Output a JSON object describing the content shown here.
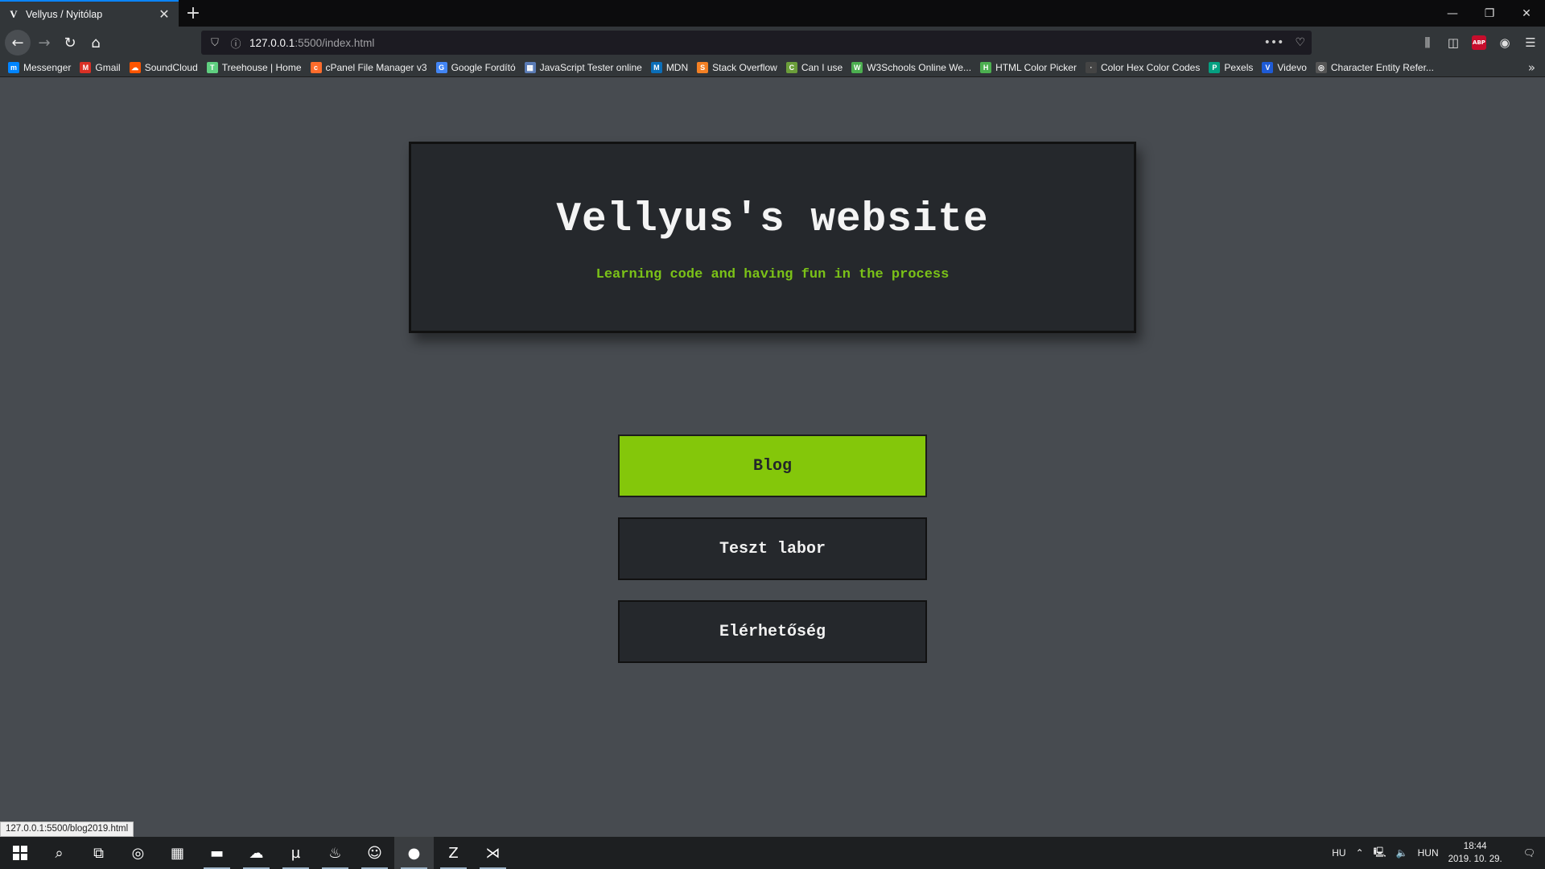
{
  "browser": {
    "tab": {
      "favicon": "V",
      "title": "Vellyus / Nyitólap"
    },
    "url": {
      "host": "127.0.0.1",
      "rest": ":5500/index.html"
    },
    "bookmarks": [
      {
        "label": "Messenger",
        "color": "#0084ff",
        "glyph": "m"
      },
      {
        "label": "Gmail",
        "color": "#d93025",
        "glyph": "M"
      },
      {
        "label": "SoundCloud",
        "color": "#ff5500",
        "glyph": "☁"
      },
      {
        "label": "Treehouse | Home",
        "color": "#5fcf80",
        "glyph": "T"
      },
      {
        "label": "cPanel File Manager v3",
        "color": "#ff6c2c",
        "glyph": "c"
      },
      {
        "label": "Google Fordító",
        "color": "#4285f4",
        "glyph": "G"
      },
      {
        "label": "JavaScript Tester online",
        "color": "#5a7bb5",
        "glyph": "▦"
      },
      {
        "label": "MDN",
        "color": "#0b6eb8",
        "glyph": "M"
      },
      {
        "label": "Stack Overflow",
        "color": "#f48024",
        "glyph": "S"
      },
      {
        "label": "Can I use",
        "color": "#6b9e3a",
        "glyph": "C"
      },
      {
        "label": "W3Schools Online We...",
        "color": "#4caf50",
        "glyph": "W"
      },
      {
        "label": "HTML Color Picker",
        "color": "#4caf50",
        "glyph": "H"
      },
      {
        "label": "Color Hex Color Codes",
        "color": "#444444",
        "glyph": "·"
      },
      {
        "label": "Pexels",
        "color": "#05a081",
        "glyph": "P"
      },
      {
        "label": "Videvo",
        "color": "#1e5bd6",
        "glyph": "V"
      },
      {
        "label": "Character Entity Refer...",
        "color": "#555555",
        "glyph": "◎"
      }
    ]
  },
  "page": {
    "title": "Vellyus's website",
    "subtitle": "Learning code and having fun in the process",
    "menu": [
      {
        "label": "Blog",
        "active": true
      },
      {
        "label": "Teszt labor",
        "active": false
      },
      {
        "label": "Elérhetőség",
        "active": false
      }
    ],
    "status_link": "127.0.0.1:5500/blog2019.html"
  },
  "taskbar": {
    "apps": [
      {
        "name": "cortana-icon",
        "glyph": "◎"
      },
      {
        "name": "calculator-icon",
        "glyph": "▦"
      },
      {
        "name": "file-explorer-icon",
        "glyph": "▬"
      },
      {
        "name": "cloud-app-icon",
        "glyph": "☁"
      },
      {
        "name": "utorrent-icon",
        "glyph": "µ"
      },
      {
        "name": "steam-icon",
        "glyph": "♨"
      },
      {
        "name": "discord-icon",
        "glyph": "☺"
      },
      {
        "name": "firefox-icon",
        "glyph": "●"
      },
      {
        "name": "filezilla-icon",
        "glyph": "Z"
      },
      {
        "name": "vscode-icon",
        "glyph": "⋊"
      }
    ],
    "tray": {
      "lang_small": "HU",
      "lang": "HUN",
      "time": "18:44",
      "date": "2019. 10. 29."
    }
  },
  "colors": {
    "accent_green": "#84c70a",
    "subtitle_green": "#7bc218",
    "card_bg": "#25282c",
    "page_bg": "#474b50"
  }
}
